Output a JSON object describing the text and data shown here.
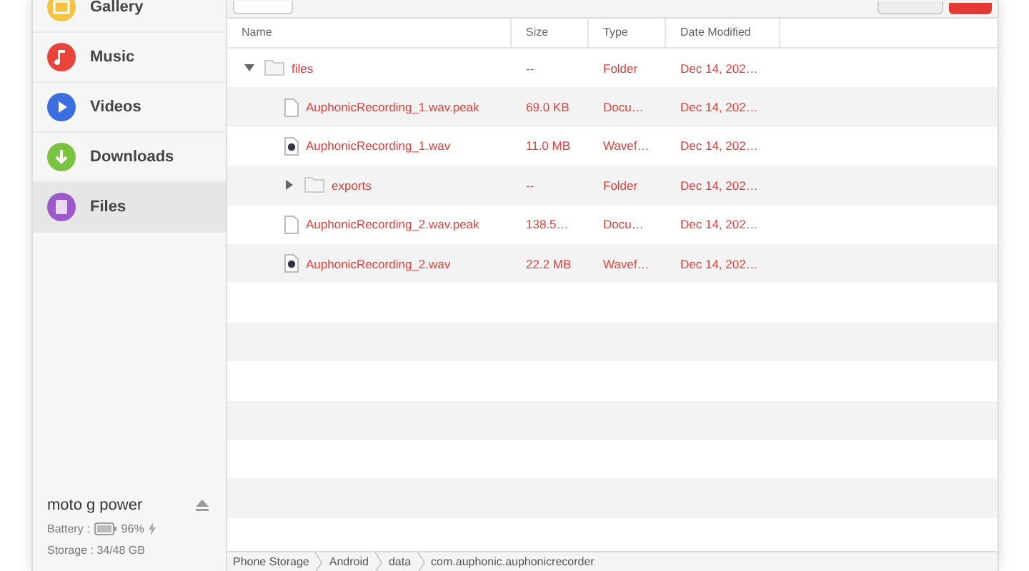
{
  "sidebar": {
    "items": [
      {
        "label": "Gallery",
        "kind": "gallery",
        "color": "#f5c342",
        "selected": false
      },
      {
        "label": "Music",
        "kind": "music",
        "color": "#e8443a",
        "selected": false
      },
      {
        "label": "Videos",
        "kind": "videos",
        "color": "#3b6fe0",
        "selected": false
      },
      {
        "label": "Downloads",
        "kind": "downloads",
        "color": "#7cc242",
        "selected": false
      },
      {
        "label": "Files",
        "kind": "files",
        "color": "#9b59c9",
        "selected": true
      }
    ],
    "device": {
      "name": "moto g power",
      "battery_label": "Battery :",
      "battery": "96%",
      "charging": true,
      "storage": "Storage : 34/48 GB"
    }
  },
  "table": {
    "columns": [
      "Name",
      "Size",
      "Type",
      "Date Modified"
    ],
    "rows": [
      {
        "name": "files",
        "kind": "folder",
        "expanded": true,
        "size": "--",
        "type": "Folder",
        "date": "Dec 14, 202…",
        "selected": true,
        "children": [
          {
            "name": "AuphonicRecording_1.wav.peak",
            "kind": "document",
            "size": "69.0 KB",
            "type": "Docu…",
            "date": "Dec 14, 202…",
            "selected": true
          },
          {
            "name": "AuphonicRecording_1.wav",
            "kind": "audio",
            "size": "11.0 MB",
            "type": "Wavef…",
            "date": "Dec 14, 202…",
            "selected": true
          },
          {
            "name": "exports",
            "kind": "folder",
            "expanded": false,
            "size": "--",
            "type": "Folder",
            "date": "Dec 14, 202…",
            "selected": true
          },
          {
            "name": "AuphonicRecording_2.wav.peak",
            "kind": "document",
            "size": "138.5…",
            "type": "Docu…",
            "date": "Dec 14, 202…",
            "selected": true
          },
          {
            "name": "AuphonicRecording_2.wav",
            "kind": "audio",
            "size": "22.2 MB",
            "type": "Wavef…",
            "date": "Dec 14, 202…",
            "selected": true
          }
        ]
      }
    ]
  },
  "breadcrumbs": [
    "Phone Storage",
    "Android",
    "data",
    "com.auphonic.auphonicrecorder"
  ]
}
